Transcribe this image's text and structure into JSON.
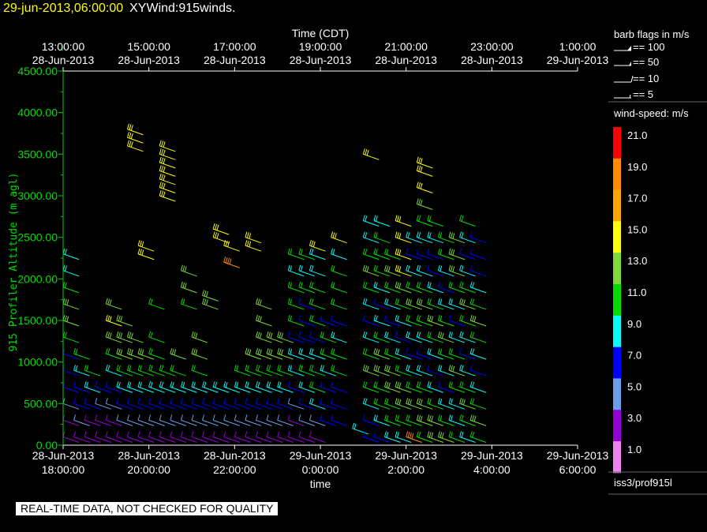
{
  "header": {
    "date": "29-jun-2013,06:00:00",
    "name": "XYWind:915winds."
  },
  "footer": {
    "disclaimer": "REAL-TIME DATA, NOT CHECKED FOR QUALITY"
  },
  "legend": {
    "barb_title": "barb flags in m/s",
    "barb_items": [
      "== 100",
      "== 50",
      "== 10",
      "== 5"
    ],
    "speed_title": "wind-speed: m/s",
    "speed_labels": [
      "21.0",
      "19.0",
      "17.0",
      "15.0",
      "13.0",
      "11.0",
      "9.0",
      "7.0",
      "5.0",
      "3.0",
      "1.0"
    ],
    "speed_colors": [
      "#ff0000",
      "#ff8c00",
      "#ffa500",
      "#ffff00",
      "#7fd93a",
      "#00dd00",
      "#00ffff",
      "#0000ff",
      "#6a9fe8",
      "#9400d3",
      "#ee82ee"
    ],
    "source": "iss3/prof915l"
  },
  "chart_data": {
    "type": "wind-barb",
    "top_axis_title": "Time (CDT)",
    "top_ticks": [
      {
        "time": "13:00:00",
        "date": "28-Jun-2013"
      },
      {
        "time": "15:00:00",
        "date": "28-Jun-2013"
      },
      {
        "time": "17:00:00",
        "date": "28-Jun-2013"
      },
      {
        "time": "19:00:00",
        "date": "28-Jun-2013"
      },
      {
        "time": "21:00:00",
        "date": "28-Jun-2013"
      },
      {
        "time": "23:00:00",
        "date": "28-Jun-2013"
      },
      {
        "time": "1:00:00",
        "date": "29-Jun-2013"
      }
    ],
    "bottom_axis_title": "time",
    "bottom_ticks": [
      {
        "date": "28-Jun-2013",
        "time": "18:00:00"
      },
      {
        "date": "28-Jun-2013",
        "time": "20:00:00"
      },
      {
        "date": "28-Jun-2013",
        "time": "22:00:00"
      },
      {
        "date": "29-Jun-2013",
        "time": "0:00:00"
      },
      {
        "date": "29-Jun-2013",
        "time": "2:00:00"
      },
      {
        "date": "29-Jun-2013",
        "time": "4:00:00"
      },
      {
        "date": "29-Jun-2013",
        "time": "6:00:00"
      }
    ],
    "ylabel": "915 Profiler Altitude (m agl)",
    "ylim": [
      0,
      4500
    ],
    "y_ticks": [
      "0.00",
      "500.00",
      "1000.00",
      "1500.00",
      "2000.00",
      "2500.00",
      "3000.00",
      "3500.00",
      "4000.00",
      "4500.00"
    ],
    "profiles": [
      {
        "time": "28-Jun-2013 18:00",
        "altitudes": [
          100,
          300,
          500,
          700,
          900,
          1100,
          1300,
          1500,
          1700,
          1900,
          2100,
          2300
        ],
        "speeds": [
          3,
          3,
          5,
          7,
          7,
          7,
          11,
          13,
          13,
          11,
          9,
          9
        ]
      },
      {
        "time": "28-Jun-2013 18:15",
        "altitudes": [
          100,
          300,
          500,
          700,
          900,
          1100
        ],
        "speeds": [
          3,
          5,
          7,
          7,
          9,
          11
        ]
      },
      {
        "time": "28-Jun-2013 18:30",
        "altitudes": [
          100,
          300,
          500,
          700,
          900
        ],
        "speeds": [
          3,
          3,
          7,
          9,
          11
        ]
      },
      {
        "time": "28-Jun-2013 18:45",
        "altitudes": [
          100,
          300,
          500,
          700
        ],
        "speeds": [
          3,
          3,
          5,
          7
        ]
      },
      {
        "time": "28-Jun-2013 19:00",
        "altitudes": [
          100,
          300,
          500,
          700,
          900,
          1100,
          1300,
          1500,
          1700
        ],
        "speeds": [
          3,
          3,
          5,
          7,
          9,
          11,
          13,
          15,
          13
        ]
      },
      {
        "time": "28-Jun-2013 19:15",
        "altitudes": [
          100,
          300,
          500,
          700,
          900,
          1100,
          1300,
          1500
        ],
        "speeds": [
          3,
          5,
          7,
          9,
          11,
          13,
          13,
          13
        ]
      },
      {
        "time": "28-Jun-2013 19:30",
        "altitudes": [
          100,
          300,
          500,
          700,
          900,
          1100,
          1300,
          3600,
          3700,
          3800
        ],
        "speeds": [
          3,
          5,
          7,
          9,
          11,
          13,
          13,
          15,
          15,
          15
        ]
      },
      {
        "time": "28-Jun-2013 19:45",
        "altitudes": [
          100,
          300,
          500,
          700,
          900,
          1100,
          2300,
          2400
        ],
        "speeds": [
          3,
          5,
          7,
          9,
          11,
          13,
          15,
          15
        ]
      },
      {
        "time": "28-Jun-2013 20:00",
        "altitudes": [
          100,
          300,
          500,
          700,
          900,
          1100,
          1300,
          1700
        ],
        "speeds": [
          3,
          5,
          7,
          9,
          11,
          11,
          11,
          11
        ]
      },
      {
        "time": "28-Jun-2013 20:15",
        "altitudes": [
          100,
          300,
          500,
          700,
          900,
          3000,
          3100,
          3200,
          3300,
          3400,
          3500,
          3600
        ],
        "speeds": [
          3,
          5,
          7,
          9,
          11,
          15,
          15,
          15,
          15,
          15,
          15,
          15
        ]
      },
      {
        "time": "28-Jun-2013 20:30",
        "altitudes": [
          100,
          300,
          500,
          700,
          900,
          1100
        ],
        "speeds": [
          3,
          5,
          7,
          9,
          11,
          13
        ]
      },
      {
        "time": "28-Jun-2013 20:45",
        "altitudes": [
          100,
          300,
          500,
          700,
          1700,
          1900,
          2100
        ],
        "speeds": [
          3,
          5,
          7,
          9,
          11,
          13,
          13
        ]
      },
      {
        "time": "28-Jun-2013 21:00",
        "altitudes": [
          100,
          300,
          500,
          700,
          900,
          1100,
          1300
        ],
        "speeds": [
          3,
          5,
          7,
          9,
          11,
          13,
          13
        ]
      },
      {
        "time": "28-Jun-2013 21:15",
        "altitudes": [
          100,
          300,
          500,
          700,
          1700,
          1800
        ],
        "speeds": [
          3,
          5,
          7,
          9,
          13,
          13
        ]
      },
      {
        "time": "28-Jun-2013 21:30",
        "altitudes": [
          100,
          300,
          500,
          700,
          2500,
          2600
        ],
        "speeds": [
          3,
          5,
          7,
          9,
          15,
          15
        ]
      },
      {
        "time": "28-Jun-2013 21:45",
        "altitudes": [
          100,
          300,
          500,
          700,
          2200,
          2400
        ],
        "speeds": [
          3,
          5,
          7,
          9,
          19,
          15
        ]
      },
      {
        "time": "28-Jun-2013 22:00",
        "altitudes": [
          100,
          300,
          500,
          700,
          900
        ],
        "speeds": [
          3,
          5,
          7,
          9,
          11
        ]
      },
      {
        "time": "28-Jun-2013 22:15",
        "altitudes": [
          100,
          300,
          500,
          700,
          900,
          1100,
          2400,
          2500
        ],
        "speeds": [
          3,
          5,
          7,
          9,
          11,
          13,
          15,
          15
        ]
      },
      {
        "time": "28-Jun-2013 22:30",
        "altitudes": [
          100,
          300,
          500,
          700,
          900,
          1100,
          1300,
          1500,
          1700
        ],
        "speeds": [
          3,
          5,
          7,
          9,
          11,
          13,
          13,
          13,
          13
        ]
      },
      {
        "time": "28-Jun-2013 22:45",
        "altitudes": [
          100,
          300,
          500,
          700,
          900,
          1100,
          1300
        ],
        "speeds": [
          3,
          5,
          7,
          9,
          11,
          13,
          13
        ]
      },
      {
        "time": "28-Jun-2013 23:00",
        "altitudes": [
          100,
          300,
          500,
          700,
          900,
          1100,
          1300
        ],
        "speeds": [
          3,
          5,
          7,
          9,
          11,
          13,
          13
        ]
      },
      {
        "time": "28-Jun-2013 23:15",
        "altitudes": [
          100,
          300,
          500,
          700,
          900,
          1100,
          1300,
          1500,
          1700,
          1900,
          2100,
          2300
        ],
        "speeds": [
          3,
          3,
          5,
          7,
          9,
          9,
          7,
          11,
          11,
          11,
          9,
          11
        ]
      },
      {
        "time": "28-Jun-2013 23:30",
        "altitudes": [
          100,
          300,
          500,
          700,
          900,
          1100,
          1300,
          1500,
          1700,
          1900,
          2100,
          2300
        ],
        "speeds": [
          3,
          5,
          7,
          9,
          11,
          9,
          7,
          7,
          7,
          11,
          9,
          11
        ]
      },
      {
        "time": "28-Jun-2013 23:45",
        "altitudes": [
          100,
          300,
          500,
          700,
          900,
          1100,
          1300,
          1500,
          1700,
          1900,
          2100,
          2300,
          2400
        ],
        "speeds": [
          3,
          5,
          9,
          11,
          11,
          9,
          7,
          11,
          11,
          11,
          9,
          9,
          15
        ]
      },
      {
        "time": "29-Jun-2013 00:00",
        "altitudes": [
          300,
          500,
          700,
          900,
          1100,
          1300,
          1500
        ],
        "speeds": [
          7,
          7,
          7,
          9,
          11,
          11,
          7
        ]
      },
      {
        "time": "29-Jun-2013 00:15",
        "altitudes": [
          300,
          500,
          700,
          900,
          1100,
          1300,
          1500,
          1700,
          1900,
          2100,
          2300,
          2500
        ],
        "speeds": [
          7,
          7,
          7,
          11,
          11,
          9,
          7,
          11,
          11,
          11,
          9,
          15
        ]
      },
      {
        "time": "29-Jun-2013 00:45",
        "altitudes": [
          200
        ],
        "speeds": [
          9
        ]
      },
      {
        "time": "29-Jun-2013 01:00",
        "altitudes": [
          100,
          300,
          500,
          700,
          900,
          1100,
          1300,
          1500,
          1700,
          1900,
          2100,
          2300,
          2500,
          2700,
          3500
        ],
        "speeds": [
          7,
          7,
          9,
          11,
          13,
          11,
          9,
          7,
          9,
          11,
          13,
          11,
          9,
          9,
          15
        ]
      },
      {
        "time": "29-Jun-2013 01:15",
        "altitudes": [
          100,
          300,
          500,
          700,
          900,
          1100,
          1300,
          1500,
          1700,
          1900,
          2100,
          2300,
          2500,
          2700
        ],
        "speeds": [
          7,
          9,
          11,
          11,
          13,
          13,
          11,
          9,
          7,
          9,
          11,
          11,
          11,
          9
        ]
      },
      {
        "time": "29-Jun-2013 01:30",
        "altitudes": [
          100,
          300,
          500,
          700,
          900,
          1100,
          1300,
          1500,
          1700,
          1900,
          2100,
          2300
        ],
        "speeds": [
          9,
          11,
          11,
          13,
          13,
          11,
          9,
          7,
          9,
          11,
          13,
          11
        ]
      },
      {
        "time": "29-Jun-2013 01:45",
        "altitudes": [
          100,
          300,
          500,
          700,
          900,
          1100,
          1300,
          1500,
          1700,
          1900,
          2100,
          2300,
          2500,
          2700
        ],
        "speeds": [
          9,
          11,
          13,
          13,
          11,
          9,
          7,
          9,
          11,
          13,
          15,
          15,
          15,
          15
        ]
      },
      {
        "time": "29-Jun-2013 02:00",
        "altitudes": [
          100,
          300,
          500,
          700,
          900,
          1100,
          1300,
          1500,
          1700,
          1900,
          2100,
          2300,
          2500
        ],
        "speeds": [
          19,
          11,
          13,
          11,
          9,
          7,
          9,
          11,
          13,
          11,
          9,
          7,
          9
        ]
      },
      {
        "time": "29-Jun-2013 02:15",
        "altitudes": [
          100,
          300,
          500,
          700,
          900,
          1100,
          1300,
          1500,
          1700,
          1900,
          2100,
          2300,
          2500,
          2700,
          2900,
          3100,
          3300,
          3400
        ],
        "speeds": [
          11,
          13,
          13,
          11,
          9,
          7,
          9,
          11,
          13,
          11,
          9,
          7,
          9,
          11,
          13,
          15,
          15,
          15
        ]
      },
      {
        "time": "29-Jun-2013 02:30",
        "altitudes": [
          100,
          300,
          500,
          700,
          900,
          1100,
          1300,
          1500,
          1700,
          1900,
          2100,
          2300,
          2500,
          2700
        ],
        "speeds": [
          13,
          13,
          11,
          9,
          7,
          9,
          11,
          13,
          11,
          9,
          7,
          7,
          9,
          11
        ]
      },
      {
        "time": "29-Jun-2013 02:45",
        "altitudes": [
          100,
          300,
          500,
          700,
          900,
          1100,
          1300,
          1500,
          1700,
          1900,
          2100,
          2300,
          2500
        ],
        "speeds": [
          13,
          11,
          9,
          7,
          9,
          11,
          13,
          11,
          9,
          7,
          9,
          11,
          11
        ]
      },
      {
        "time": "29-Jun-2013 03:00",
        "altitudes": [
          100,
          300,
          500,
          700,
          900,
          1100,
          1300,
          1500,
          1700,
          1900,
          2100,
          2300,
          2500
        ],
        "speeds": [
          11,
          9,
          9,
          11,
          13,
          11,
          9,
          7,
          9,
          11,
          13,
          13,
          13
        ]
      },
      {
        "time": "29-Jun-2013 03:15",
        "altitudes": [
          100,
          300,
          500,
          700,
          900,
          1100,
          1300,
          1500,
          1700,
          1900,
          2100,
          2300,
          2500,
          2700
        ],
        "speeds": [
          9,
          11,
          13,
          11,
          9,
          7,
          9,
          11,
          13,
          11,
          9,
          7,
          9,
          11
        ]
      },
      {
        "time": "29-Jun-2013 03:30",
        "altitudes": [
          100,
          300,
          500,
          700,
          900,
          1100,
          1300,
          1500,
          1700,
          1900,
          2100,
          2300,
          2500
        ],
        "speeds": [
          11,
          13,
          11,
          9,
          7,
          9,
          11,
          13,
          11,
          9,
          7,
          7,
          7
        ]
      }
    ]
  }
}
